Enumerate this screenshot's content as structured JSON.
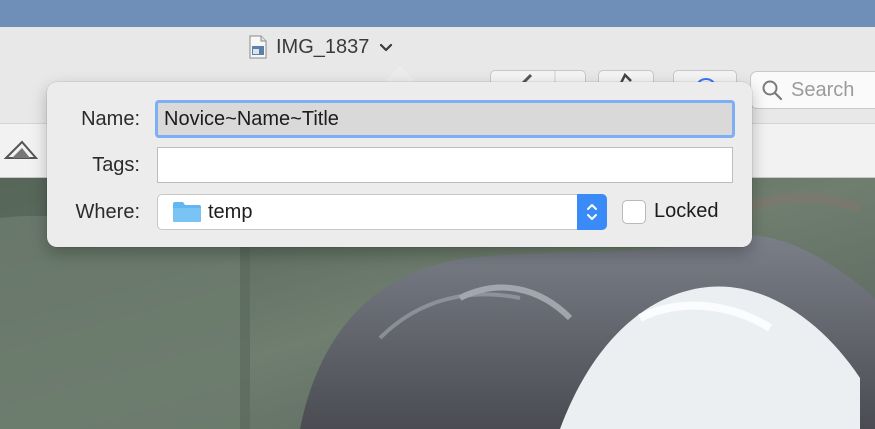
{
  "window": {
    "title": "IMG_1837"
  },
  "toolbar": {
    "search_placeholder": "Search"
  },
  "rename_popover": {
    "name_label": "Name:",
    "name_value": "Novice~Name~Title",
    "tags_label": "Tags:",
    "tags_value": "",
    "where_label": "Where:",
    "where_value": "temp",
    "locked_label": "Locked",
    "locked_checked": false
  },
  "colors": {
    "focus_ring": "#7eaef5",
    "stepper_accent": "#3a8af7",
    "folder": "#63b6f1"
  }
}
